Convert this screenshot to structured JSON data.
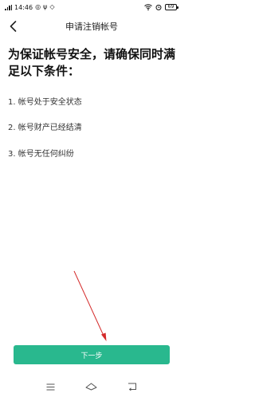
{
  "status_bar": {
    "time": "14:46",
    "battery": "69"
  },
  "nav": {
    "title": "申请注销帐号"
  },
  "content": {
    "headline": "为保证帐号安全，请确保同时满足以下条件：",
    "conditions": [
      "1. 帐号处于安全状态",
      "2. 帐号财产已经结清",
      "3. 帐号无任何纠纷"
    ]
  },
  "footer": {
    "next_label": "下一步"
  },
  "icons": {
    "back": "chevron-left-icon",
    "menu": "menu-icon",
    "home": "home-icon",
    "return": "return-icon"
  },
  "colors": {
    "primary_button": "#29b88e",
    "annotation_arrow": "#d42a2a"
  }
}
